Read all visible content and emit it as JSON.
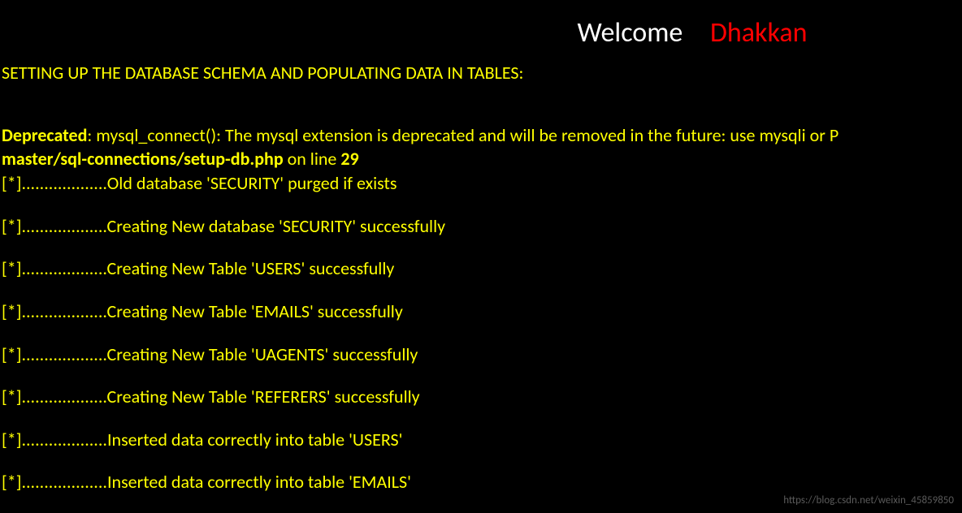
{
  "header": {
    "welcome": "Welcome",
    "name": "Dhakkan"
  },
  "heading": "SETTING UP THE DATABASE SCHEMA AND POPULATING DATA IN TABLES:",
  "deprecated": {
    "label": "Deprecated",
    "message": ": mysql_connect(): The mysql extension is deprecated and will be removed in the future: use mysqli or P",
    "path": "master/sql-connections/setup-db.php",
    "onLine": " on line ",
    "lineNum": "29"
  },
  "logs": [
    "[*]...................Old database 'SECURITY' purged if exists",
    "[*]...................Creating New database 'SECURITY' successfully",
    "[*]...................Creating New Table 'USERS' successfully",
    "[*]...................Creating New Table 'EMAILS' successfully",
    "[*]...................Creating New Table 'UAGENTS' successfully",
    "[*]...................Creating New Table 'REFERERS' successfully",
    "[*]...................Inserted data correctly into table 'USERS'",
    "[*]...................Inserted data correctly into table 'EMAILS'"
  ],
  "watermark": "https://blog.csdn.net/weixin_45859850"
}
